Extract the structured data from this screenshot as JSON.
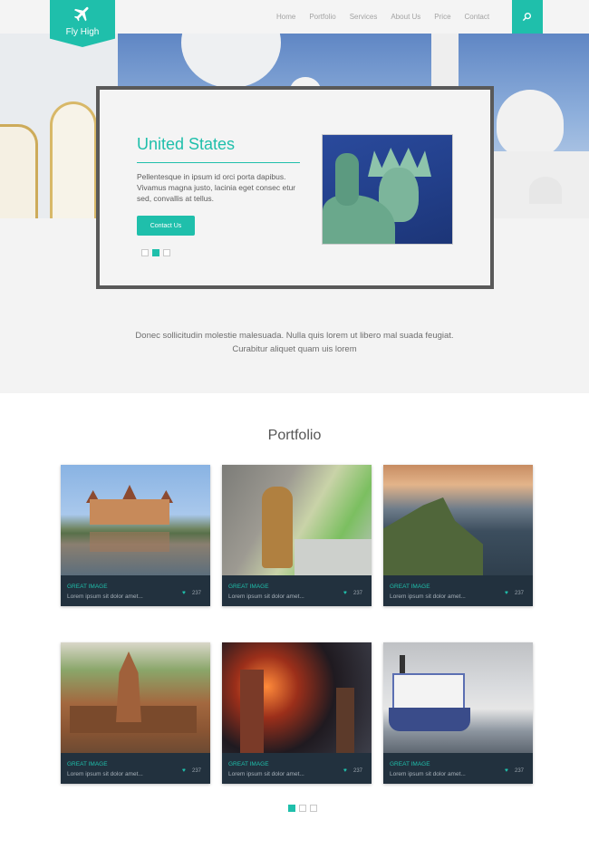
{
  "brand": {
    "name": "Fly High",
    "icon": "airplane-icon",
    "accent": "#1fbfab"
  },
  "nav": {
    "items": [
      "Home",
      "Portfolio",
      "Services",
      "About Us",
      "Price",
      "Contact"
    ],
    "search_icon": "search-icon"
  },
  "slider": {
    "title": "United States",
    "text": "Pellentesque in ipsum id orci porta dapibus. Vivamus magna justo, lacinia eget consec etur sed, convallis at tellus.",
    "button": "Contact Us",
    "active_slide": 2,
    "slide_count": 3
  },
  "intro": "Donec sollicitudin molestie malesuada. Nulla quis lorem ut libero mal suada feugiat. Curabitur aliquet quam uis lorem",
  "portfolio": {
    "title": "Portfolio",
    "items": [
      {
        "title": "GREAT IMAGE",
        "text": "Lorem ipsum sit dolor amet...",
        "likes": "237"
      },
      {
        "title": "GREAT IMAGE",
        "text": "Lorem ipsum sit dolor amet...",
        "likes": "237"
      },
      {
        "title": "GREAT IMAGE",
        "text": "Lorem ipsum sit dolor amet...",
        "likes": "237"
      },
      {
        "title": "GREAT IMAGE",
        "text": "Lorem ipsum sit dolor amet...",
        "likes": "237"
      },
      {
        "title": "GREAT IMAGE",
        "text": "Lorem ipsum sit dolor amet...",
        "likes": "237"
      },
      {
        "title": "GREAT IMAGE",
        "text": "Lorem ipsum sit dolor amet...",
        "likes": "237"
      }
    ],
    "active_page": 1,
    "page_count": 3
  }
}
